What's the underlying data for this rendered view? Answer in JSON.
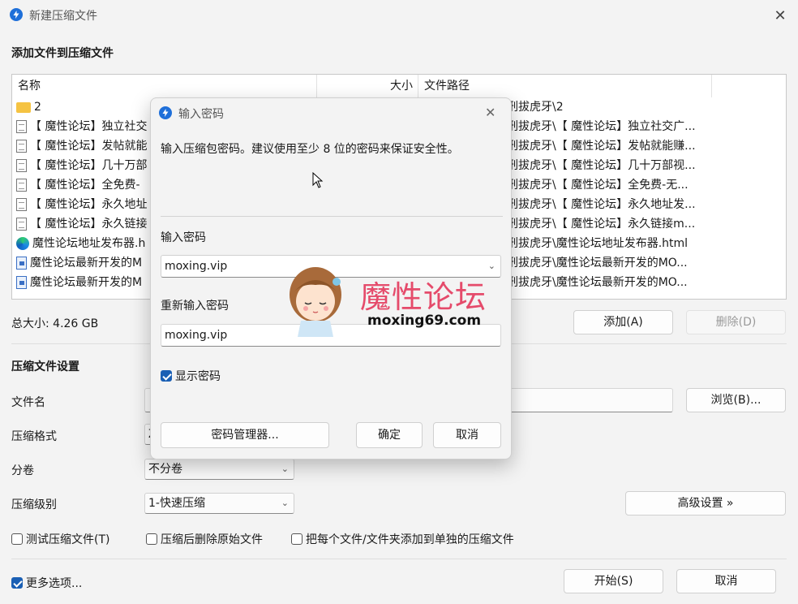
{
  "window": {
    "title": "新建压缩文件",
    "close_icon": "close-icon"
  },
  "add_section": {
    "title": "添加文件到压缩文件",
    "columns": [
      "名称",
      "大小",
      "文件路径"
    ],
    "rows": [
      {
        "icon": "folder-icon",
        "name": "2",
        "path": "刑拔虎牙\\2"
      },
      {
        "icon": "file-icon",
        "name": "【 魔性论坛】独立社交",
        "path": "刑拔虎牙\\【 魔性论坛】独立社交广..."
      },
      {
        "icon": "file-icon",
        "name": "【 魔性论坛】发帖就能",
        "path": "刑拔虎牙\\【 魔性论坛】发帖就能赚..."
      },
      {
        "icon": "file-icon",
        "name": "【 魔性论坛】几十万部",
        "path": "刑拔虎牙\\【 魔性论坛】几十万部视..."
      },
      {
        "icon": "file-icon",
        "name": "【 魔性论坛】全免费-",
        "path": "刑拔虎牙\\【 魔性论坛】全免费-无..."
      },
      {
        "icon": "file-icon",
        "name": "【 魔性论坛】永久地址",
        "path": "刑拔虎牙\\【 魔性论坛】永久地址发..."
      },
      {
        "icon": "file-icon",
        "name": "【 魔性论坛】永久链接",
        "path": "刑拔虎牙\\【 魔性论坛】永久链接m..."
      },
      {
        "icon": "edge-icon",
        "name": "魔性论坛地址发布器.h",
        "path": "刑拔虎牙\\魔性论坛地址发布器.html"
      },
      {
        "icon": "doc-icon",
        "name": "魔性论坛最新开发的M",
        "path": "刑拔虎牙\\魔性论坛最新开发的MO..."
      },
      {
        "icon": "doc-icon",
        "name": "魔性论坛最新开发的M",
        "path": "刑拔虎牙\\魔性论坛最新开发的MO..."
      }
    ],
    "total_size": "总大小: 4.26 GB",
    "add_button": "添加(A)",
    "delete_button": "删除(D)"
  },
  "settings": {
    "title": "压缩文件设置",
    "filename_label": "文件名",
    "filename_value": "",
    "browse_button": "浏览(B)...",
    "format_label": "压缩格式",
    "format_value": "Z",
    "split_label": "分卷",
    "split_value": "不分卷",
    "level_label": "压缩级别",
    "level_value": "1-快速压缩",
    "advanced_button": "高级设置 »",
    "test_checkbox": "测试压缩文件(T)",
    "delete_after_checkbox": "压缩后删除原始文件",
    "separate_checkbox": "把每个文件/文件夹添加到单独的压缩文件",
    "more_options": "更多选项...",
    "start_button": "开始(S)",
    "cancel_button": "取消"
  },
  "password_dialog": {
    "title": "输入密码",
    "message": "输入压缩包密码。建议使用至少 8 位的密码来保证安全性。",
    "password_label": "输入密码",
    "password_value": "moxing.vip",
    "confirm_label": "重新输入密码",
    "confirm_value": "moxing.vip",
    "show_password": "显示密码",
    "manager_button": "密码管理器...",
    "ok_button": "确定",
    "cancel_button": "取消"
  },
  "watermark": {
    "brand": "魔性论坛",
    "url": "moxing69.com"
  },
  "colors": {
    "accent": "#1a5fb4",
    "brand_pink": "#e54b6b"
  }
}
